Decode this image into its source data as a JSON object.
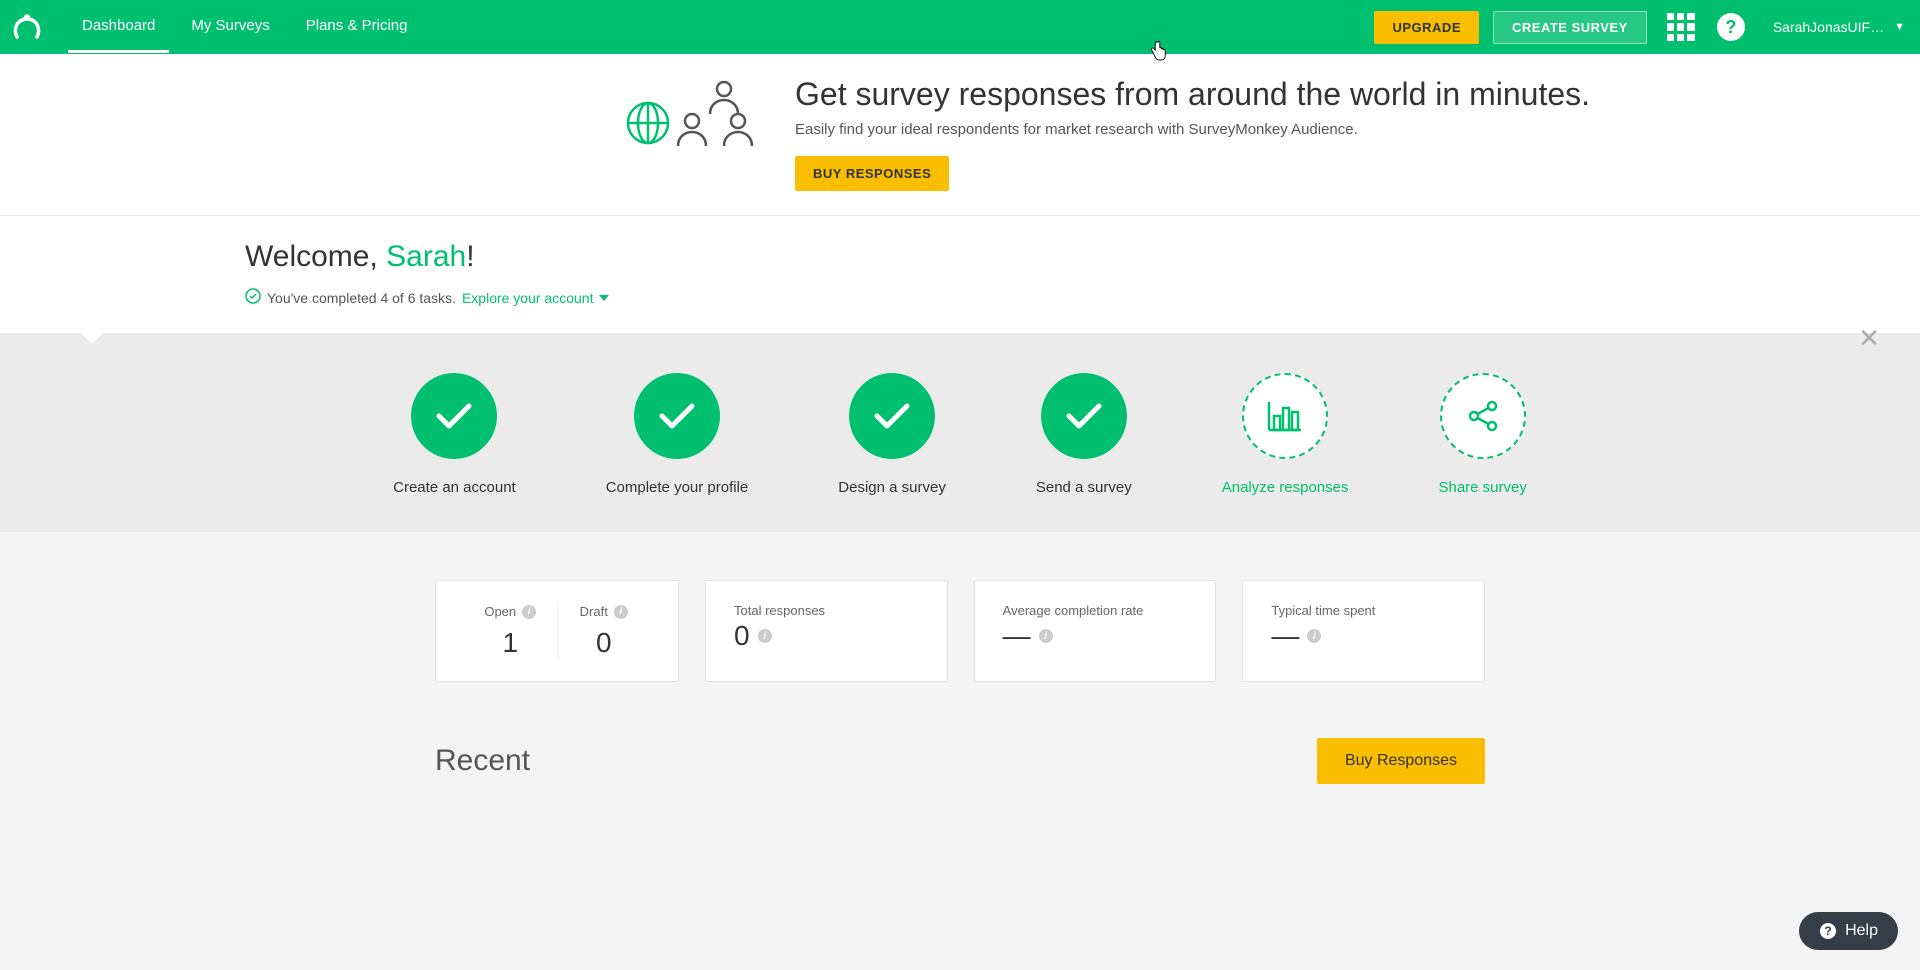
{
  "nav": {
    "links": [
      "Dashboard",
      "My Surveys",
      "Plans & Pricing"
    ],
    "upgrade": "UPGRADE",
    "create_survey": "CREATE SURVEY",
    "username": "SarahJonasUIF…"
  },
  "promo": {
    "title": "Get survey responses from around the world in minutes.",
    "subtitle": "Easily find your ideal respondents for market research with SurveyMonkey Audience.",
    "cta": "BUY RESPONSES"
  },
  "welcome": {
    "prefix": "Welcome, ",
    "name": "Sarah",
    "suffix": "!",
    "tasks_text": "You've completed 4 of 6 tasks.",
    "explore": "Explore your account"
  },
  "tasks": [
    {
      "label": "Create an account",
      "done": true
    },
    {
      "label": "Complete your profile",
      "done": true
    },
    {
      "label": "Design a survey",
      "done": true
    },
    {
      "label": "Send a survey",
      "done": true
    },
    {
      "label": "Analyze responses",
      "done": false,
      "icon": "chart"
    },
    {
      "label": "Share survey",
      "done": false,
      "icon": "share"
    }
  ],
  "stats": {
    "open_label": "Open",
    "open_value": "1",
    "draft_label": "Draft",
    "draft_value": "0",
    "total_label": "Total responses",
    "total_value": "0",
    "avg_label": "Average completion rate",
    "avg_value": "—",
    "time_label": "Typical time spent",
    "time_value": "—"
  },
  "recent": {
    "title": "Recent",
    "buy": "Buy Responses"
  },
  "help_widget": "Help"
}
